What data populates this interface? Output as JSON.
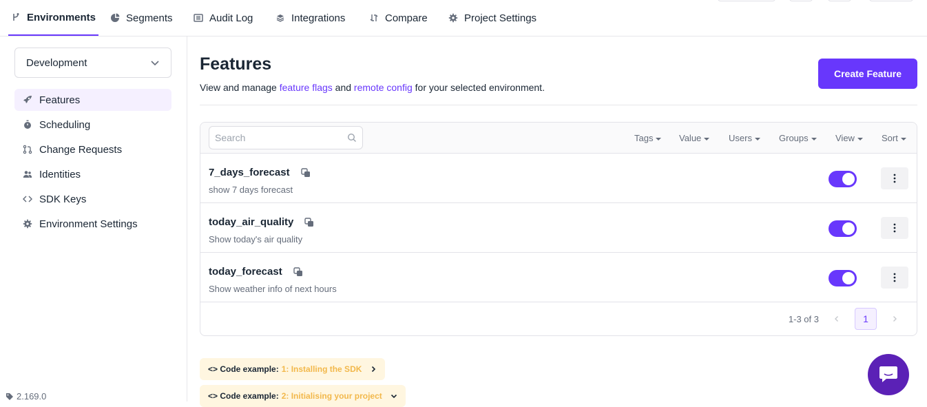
{
  "nav": {
    "tabs": [
      {
        "label": "Environments",
        "icon": "branch-icon"
      },
      {
        "label": "Segments",
        "icon": "pie-chart-icon"
      },
      {
        "label": "Audit Log",
        "icon": "list-icon"
      },
      {
        "label": "Integrations",
        "icon": "layers-icon"
      },
      {
        "label": "Compare",
        "icon": "compare-icon"
      },
      {
        "label": "Project Settings",
        "icon": "gear-icon"
      }
    ]
  },
  "sidebar": {
    "environment": "Development",
    "items": [
      {
        "label": "Features",
        "icon": "rocket-icon"
      },
      {
        "label": "Scheduling",
        "icon": "timer-icon"
      },
      {
        "label": "Change Requests",
        "icon": "pull-request-icon"
      },
      {
        "label": "Identities",
        "icon": "people-icon"
      },
      {
        "label": "SDK Keys",
        "icon": "code-icon"
      },
      {
        "label": "Environment Settings",
        "icon": "gear-icon"
      }
    ],
    "version": "2.169.0"
  },
  "main": {
    "title": "Features",
    "desc_pre": "View and manage ",
    "desc_link1": "feature flags",
    "desc_mid": " and ",
    "desc_link2": "remote config",
    "desc_post": " for your selected environment.",
    "create_label": "Create Feature"
  },
  "table": {
    "search_placeholder": "Search",
    "filters": [
      "Tags",
      "Value",
      "Users",
      "Groups",
      "View",
      "Sort"
    ],
    "rows": [
      {
        "name": "7_days_forecast",
        "desc": "show 7 days forecast",
        "enabled": true
      },
      {
        "name": "today_air_quality",
        "desc": "Show today's air quality",
        "enabled": true
      },
      {
        "name": "today_forecast",
        "desc": "Show weather info of next hours",
        "enabled": true
      }
    ],
    "pagination": {
      "range": "1-3 of 3",
      "current": "1"
    }
  },
  "code_examples": [
    {
      "prefix": "<> Code example: ",
      "highlight": "1: Installing the SDK"
    },
    {
      "prefix": "<> Code example: ",
      "highlight": "2: Initialising your project"
    }
  ],
  "colors": {
    "accent": "#6837fc",
    "chat": "#5b21b6",
    "code_bg": "#fff6e0",
    "code_highlight": "#f2b84b"
  }
}
